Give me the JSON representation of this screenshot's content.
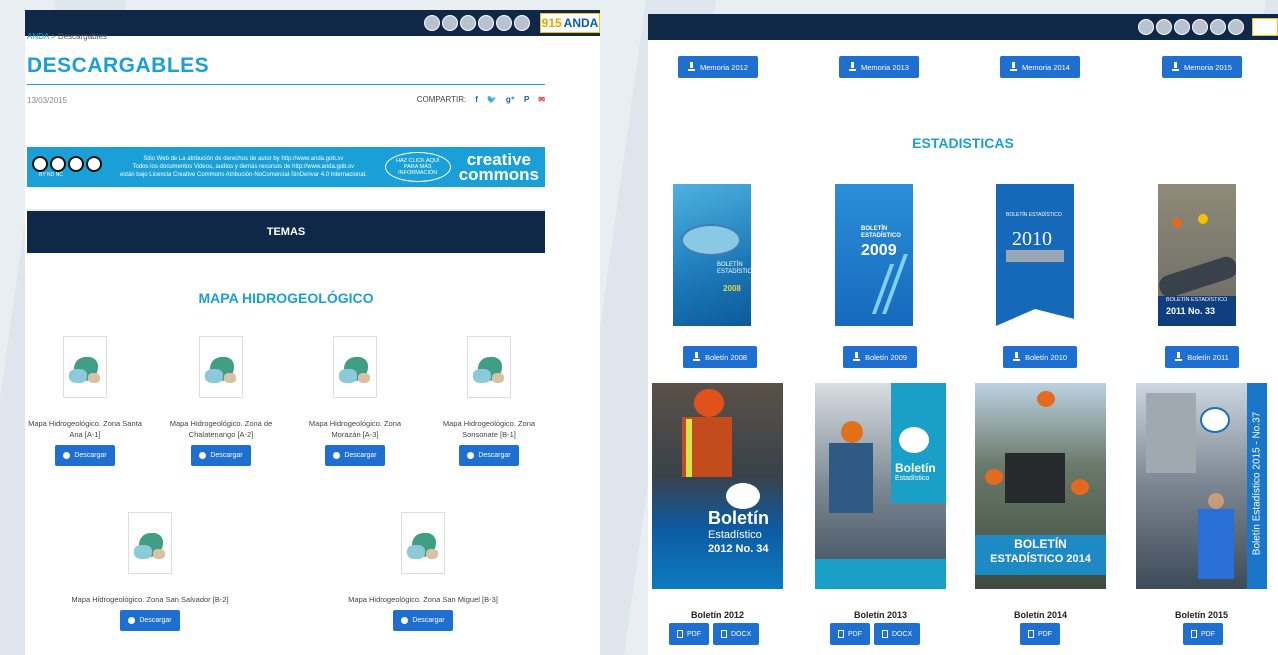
{
  "left_panel": {
    "breadcrumb": {
      "home": "ANDA",
      "separator": " > ",
      "current": "Descargables"
    },
    "title": "DESCARGABLES",
    "date": "13/03/2015",
    "share_label": "COMPARTIR:",
    "share_icons": [
      "f",
      "🐦",
      "g⁺",
      "P",
      "✉"
    ],
    "license": {
      "text_line1": "Sitio Web de La atribución de derechos de autor by  http://www.anda.gob.sv",
      "text_line2": "Todos los documentos Videos, audios y demás recursos de http://www.anda.gob.sv",
      "text_line3": "están bajo Licencia Creative Commons Atribución-NoComercial-SinDerivar 4.0 Internacional.",
      "click_text": "HAZ CLICK AQUÍ PARA MÁS INFORMACIÓN",
      "cc_badges": "BY  ND  NC",
      "logo_line1": "creative",
      "logo_line2": "commons"
    },
    "temas_label": "TEMAS",
    "section_title": "MAPA HIDROGEOLÓGICO",
    "maps": [
      {
        "label": "Mapa Hidrogeológico. Zona Santa Ana [A-1]"
      },
      {
        "label": "Mapa Hidrogeológico. Zona de Chalatenango [A-2]"
      },
      {
        "label": "Mapa Hidrogeológico. Zona Morazán [A-3]"
      },
      {
        "label": "Mapa Hidrogeológico. Zona Sonsonate [B-1]"
      },
      {
        "label": "Mapa Hidrogeológico. Zona San Salvador [B-2]"
      },
      {
        "label": "Mapa Hidrogeológico. Zona San Miguel [B-3]"
      }
    ],
    "download_label": "Descargar"
  },
  "header": {
    "phone_number": "915",
    "brand": "ANDA"
  },
  "right_panel": {
    "memorias": [
      "Memoria 2012",
      "Memoria 2013",
      "Memoria 2014",
      "Memoria 2015"
    ],
    "section_title": "ESTADISTICAS",
    "covers_top": [
      {
        "year": "2008",
        "text": "BOLETÍN ESTADÍSTICO"
      },
      {
        "year": "2009",
        "text": "BOLETÍN ESTADÍSTICO"
      },
      {
        "year": "2010",
        "text": "BOLETÍN ESTADÍSTICO"
      },
      {
        "year": "2011 No. 33",
        "text": "BOLETÍN ESTADÍSTICO"
      }
    ],
    "boletin_buttons": [
      "Boletín 2008",
      "Boletín 2009",
      "Boletín 2010",
      "Boletín 2011"
    ],
    "covers_bottom": [
      {
        "line1": "Boletín",
        "line2": "Estadístico",
        "line3": "2012 No. 34"
      },
      {
        "line1": "Boletín",
        "line2": "Estadístico",
        "line3": ""
      },
      {
        "line1": "BOLETÍN",
        "line2": "ESTADÍSTICO 2014",
        "line3": ""
      },
      {
        "line1": "Boletín Estadístico 2015 - No.37",
        "line2": "",
        "line3": ""
      }
    ],
    "boletines": [
      {
        "title": "Boletín 2012",
        "formats": [
          "PDF",
          "DOCX"
        ]
      },
      {
        "title": "Boletín 2013",
        "formats": [
          "PDF",
          "DOCX"
        ]
      },
      {
        "title": "Boletín 2014",
        "formats": [
          "PDF"
        ]
      },
      {
        "title": "Boletín 2015",
        "formats": [
          "PDF"
        ]
      }
    ],
    "colors": {
      "navy": "#0f2847",
      "accent": "#1a9fd8",
      "button": "#1f6fd0"
    }
  }
}
